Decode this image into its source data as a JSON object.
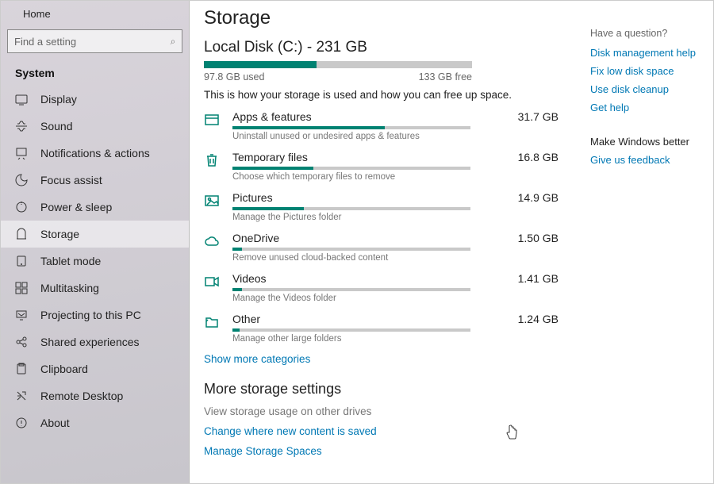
{
  "sidebar": {
    "home_label": "Home",
    "search_placeholder": "Find a setting",
    "section_label": "System",
    "items": [
      {
        "label": "Display"
      },
      {
        "label": "Sound"
      },
      {
        "label": "Notifications & actions"
      },
      {
        "label": "Focus assist"
      },
      {
        "label": "Power & sleep"
      },
      {
        "label": "Storage"
      },
      {
        "label": "Tablet mode"
      },
      {
        "label": "Multitasking"
      },
      {
        "label": "Projecting to this PC"
      },
      {
        "label": "Shared experiences"
      },
      {
        "label": "Clipboard"
      },
      {
        "label": "Remote Desktop"
      },
      {
        "label": "About"
      }
    ],
    "active_index": 5
  },
  "main": {
    "page_title": "Storage",
    "disk_title": "Local Disk (C:) - 231 GB",
    "disk_used_label": "97.8 GB used",
    "disk_free_label": "133 GB free",
    "disk_used_pct": 42,
    "intro": "This is how your storage is used and how you can free up space.",
    "categories": [
      {
        "name": "Apps & features",
        "size": "31.7 GB",
        "pct": 64,
        "desc": "Uninstall unused or undesired apps & features",
        "icon": "window"
      },
      {
        "name": "Temporary files",
        "size": "16.8 GB",
        "pct": 34,
        "desc": "Choose which temporary files to remove",
        "icon": "trash"
      },
      {
        "name": "Pictures",
        "size": "14.9 GB",
        "pct": 30,
        "desc": "Manage the Pictures folder",
        "icon": "picture"
      },
      {
        "name": "OneDrive",
        "size": "1.50 GB",
        "pct": 4,
        "desc": "Remove unused cloud-backed content",
        "icon": "cloud"
      },
      {
        "name": "Videos",
        "size": "1.41 GB",
        "pct": 4,
        "desc": "Manage the Videos folder",
        "icon": "video"
      },
      {
        "name": "Other",
        "size": "1.24 GB",
        "pct": 3,
        "desc": "Manage other large folders",
        "icon": "folder"
      }
    ],
    "show_more_label": "Show more categories",
    "more_settings_title": "More storage settings",
    "more_links": [
      {
        "label": "View storage usage on other drives",
        "dim": true
      },
      {
        "label": "Change where new content is saved",
        "dim": false
      },
      {
        "label": "Manage Storage Spaces",
        "dim": false
      }
    ]
  },
  "right": {
    "question": "Have a question?",
    "links": [
      "Disk management help",
      "Fix low disk space",
      "Use disk cleanup",
      "Get help"
    ],
    "better_title": "Make Windows better",
    "feedback": "Give us feedback"
  }
}
